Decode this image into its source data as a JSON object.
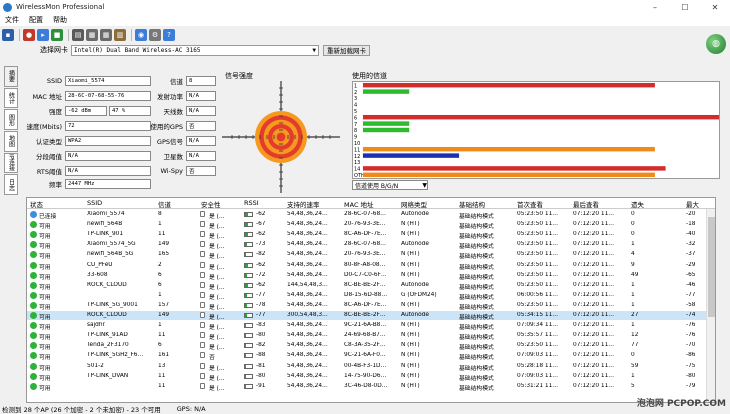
{
  "window": {
    "title": "WirelessMon Professional",
    "min": "–",
    "max": "☐",
    "close": "✕"
  },
  "menu": [
    "文件",
    "配置",
    "帮助"
  ],
  "toolbar": {
    "icons": [
      {
        "name": "save-icon",
        "color": "#2b5fa8",
        "glyph": "▪"
      },
      {
        "name": "record-icon",
        "color": "#c0392b",
        "glyph": "●"
      },
      {
        "name": "play-icon",
        "color": "#3b7dd8",
        "glyph": "▸"
      },
      {
        "name": "stop-icon",
        "color": "#2f8f3a",
        "glyph": "■"
      },
      {
        "name": "export-icon",
        "color": "#5a5a5a",
        "glyph": "▤"
      },
      {
        "name": "print-icon",
        "color": "#6b6b6b",
        "glyph": "▦"
      },
      {
        "name": "print-preview-icon",
        "color": "#6b6b6b",
        "glyph": "▦"
      },
      {
        "name": "log-icon",
        "color": "#8a6d3b",
        "glyph": "▥"
      },
      {
        "name": "wifi-icon",
        "color": "#3b7dd8",
        "glyph": "◉"
      },
      {
        "name": "settings-icon",
        "color": "#777",
        "glyph": "⚙"
      },
      {
        "name": "help-icon",
        "color": "#3b7dd8",
        "glyph": "?"
      }
    ]
  },
  "adapter": {
    "label": "选择网卡",
    "value": "Intel(R) Dual Band Wireless-AC 3165",
    "reload": "重新加载网卡"
  },
  "side_tabs": [
    "摘要",
    "统计",
    "图形",
    "地图",
    "IP连接",
    "日志"
  ],
  "info": {
    "ssid_label": "SSID",
    "ssid": "Xiaomi_5574",
    "mac_label": "MAC 地址",
    "mac": "28-6C-07-68-55-76",
    "strength_label": "强度",
    "strength_dbm": "-62 dBm",
    "strength_pct": "47 %",
    "rate_label": "速度(Mbits)",
    "rate": "72",
    "auth_label": "认证类型",
    "auth": "WPA2",
    "frag_label": "分段阈值",
    "frag": "N/A",
    "rts_label": "RTS阈值",
    "rts": "N/A",
    "freq_label": "频率",
    "freq": "2447 MHz",
    "channel_label": "信道",
    "channel": "8",
    "txpower_label": "发射功率",
    "txpower": "N/A",
    "antenna_label": "天线数",
    "antenna": "N/A",
    "gps_label": "使用的GPS",
    "gps": "否",
    "gpsnum_label": "GPS信号",
    "gpsnum": "N/A",
    "sat_label": "卫星数",
    "sat": "N/A",
    "wispy_label": "Wi-Spy",
    "wispy": "否"
  },
  "signal": {
    "title": "信号强度",
    "level_pct": 47,
    "rings": [
      "#f59a1e",
      "#e43c2c",
      "#f59a1e",
      "#e43c2c",
      "#f59a1e",
      "#e43c2c"
    ]
  },
  "channels": {
    "title": "使用的信道",
    "labels": [
      "1",
      "2",
      "3",
      "4",
      "5",
      "6",
      "7",
      "8",
      "9",
      "10",
      "11",
      "12",
      "13",
      "14",
      "OTH"
    ],
    "bars": [
      {
        "channel": "1",
        "value": 82,
        "color": "#d42b2b"
      },
      {
        "channel": "2",
        "value": 13,
        "color": "#2dbb2d"
      },
      {
        "channel": "6",
        "value": 100,
        "color": "#d42b2b"
      },
      {
        "channel": "7",
        "value": 13,
        "color": "#2dbb2d"
      },
      {
        "channel": "8",
        "value": 13,
        "color": "#2dbb2d"
      },
      {
        "channel": "11",
        "value": 82,
        "color": "#f08a18"
      },
      {
        "channel": "12",
        "value": 27,
        "color": "#1b2fb5"
      },
      {
        "channel": "14",
        "value": 85,
        "color": "#d42b2b"
      },
      {
        "channel": "OTH",
        "value": 82,
        "color": "#f08a18"
      }
    ],
    "filter": "信道使用 B/G/N"
  },
  "table": {
    "headers": [
      "状态",
      "SSID",
      "信道",
      "安全性",
      "RSSI",
      "支持的速率",
      "MAC 地址",
      "网络类型",
      "基础结构",
      "首次查看",
      "最后查看",
      "遗失",
      "最大"
    ],
    "rows": [
      {
        "status": "已连接",
        "ssid": "Xiaomi_5574",
        "ch": "8",
        "sec": "是 (…",
        "rssi": "-62",
        "rssi_fill": 47,
        "rates": "54,48,36,24…",
        "mac": "28-6C-07-68…",
        "ntype": "Autonode",
        "infra": "基础结构模式",
        "first": "05:23:50 11…",
        "last": "07:12:20 11…",
        "lost": "0",
        "max": "-20",
        "dot": "#3f8de0"
      },
      {
        "status": "可用",
        "ssid": "newifi_564B",
        "ch": "1",
        "sec": "是 (…",
        "rssi": "-67",
        "rssi_fill": 40,
        "rates": "54,48,36,24…",
        "mac": "20-76-93-3E…",
        "ntype": "N (HT)",
        "infra": "基础结构模式",
        "first": "05:23:50 11…",
        "last": "07:12:20 11…",
        "lost": "0",
        "max": "-18",
        "dot": "#2db23a"
      },
      {
        "status": "可用",
        "ssid": "TP-LINK_901",
        "ch": "11",
        "sec": "是 (…",
        "rssi": "-62",
        "rssi_fill": 47,
        "rates": "54,48,36,24…",
        "mac": "8C-A6-DF-7E…",
        "ntype": "N (HT)",
        "infra": "基础结构模式",
        "first": "05:23:50 11…",
        "last": "07:12:20 11…",
        "lost": "0",
        "max": "-40",
        "dot": "#2db23a"
      },
      {
        "status": "可用",
        "ssid": "Xiaomi_5574_5G",
        "ch": "149",
        "sec": "是 (…",
        "rssi": "-73",
        "rssi_fill": 30,
        "rates": "54,48,36,24…",
        "mac": "28-6C-07-68…",
        "ntype": "Autonode",
        "infra": "基础结构模式",
        "first": "05:23:50 11…",
        "last": "07:12:20 11…",
        "lost": "1",
        "max": "-32",
        "dot": "#2db23a"
      },
      {
        "status": "可用",
        "ssid": "newifi_564B_5G",
        "ch": "165",
        "sec": "是 (…",
        "rssi": "-82",
        "rssi_fill": 15,
        "rates": "54,48,36,24…",
        "mac": "20-76-93-3E…",
        "ntype": "N (HT)",
        "infra": "基础结构模式",
        "first": "05:23:50 11…",
        "last": "07:12:20 11…",
        "lost": "4",
        "max": "-37",
        "dot": "#2db23a"
      },
      {
        "status": "可用",
        "ssid": "CU_PFeU",
        "ch": "2",
        "sec": "是 (…",
        "rssi": "-62",
        "rssi_fill": 47,
        "rates": "54,48,36,24…",
        "mac": "80-8F-A8-08…",
        "ntype": "N (HT)",
        "infra": "基础结构模式",
        "first": "05:23:50 11…",
        "last": "07:12:20 11…",
        "lost": "9",
        "max": "-29",
        "dot": "#2db23a"
      },
      {
        "status": "可用",
        "ssid": "33-608",
        "ch": "6",
        "sec": "是 (…",
        "rssi": "-72",
        "rssi_fill": 32,
        "rates": "54,48,36,24…",
        "mac": "D0-C7-C0-6F…",
        "ntype": "N (HT)",
        "infra": "基础结构模式",
        "first": "05:23:50 11…",
        "last": "07:12:20 11…",
        "lost": "49",
        "max": "-65",
        "dot": "#2db23a"
      },
      {
        "status": "可用",
        "ssid": "ROCK_CLOUD",
        "ch": "6",
        "sec": "是 (…",
        "rssi": "-62",
        "rssi_fill": 47,
        "rates": "144,54,48,3…",
        "mac": "8C-BE-BE-2F…",
        "ntype": "Autonode",
        "infra": "基础结构模式",
        "first": "05:23:50 11…",
        "last": "07:12:20 11…",
        "lost": "1",
        "max": "-46",
        "dot": "#2db23a"
      },
      {
        "status": "可用",
        "ssid": "",
        "ch": "1",
        "sec": "是 (…",
        "rssi": "-77",
        "rssi_fill": 24,
        "rates": "54,48,36,24…",
        "mac": "D8-15-6D-88…",
        "ntype": "G (OFDM24)",
        "infra": "基础结构模式",
        "first": "06:00:56 11…",
        "last": "07:12:20 11…",
        "lost": "1",
        "max": "-77",
        "dot": "#2db23a"
      },
      {
        "status": "可用",
        "ssid": "TP-LINK_5G_9001",
        "ch": "157",
        "sec": "是 (…",
        "rssi": "-78",
        "rssi_fill": 22,
        "rates": "54,48,36,24…",
        "mac": "8C-A6-DF-7E…",
        "ntype": "N (HT)",
        "infra": "基础结构模式",
        "first": "05:23:50 11…",
        "last": "07:12:20 11…",
        "lost": "1",
        "max": "-58",
        "dot": "#2db23a"
      },
      {
        "status": "可用",
        "ssid": "ROCK_CLOUD",
        "ch": "149",
        "sec": "是 (…",
        "rssi": "-77",
        "rssi_fill": 24,
        "rates": "300,54,48,3…",
        "mac": "8C-BE-BE-2F…",
        "ntype": "Autonode",
        "infra": "基础结构模式",
        "first": "05:34:15 11…",
        "last": "07:12:20 11…",
        "lost": "27",
        "max": "-74",
        "dot": "#2db23a"
      },
      {
        "status": "可用",
        "ssid": "sajdhr",
        "ch": "1",
        "sec": "是 (…",
        "rssi": "-83",
        "rssi_fill": 13,
        "rates": "54,48,36,24…",
        "mac": "9C-21-6A-B8…",
        "ntype": "N (HT)",
        "infra": "基础结构模式",
        "first": "07:09:34 11…",
        "last": "07:12:20 11…",
        "lost": "1",
        "max": "-76",
        "dot": "#2db23a"
      },
      {
        "status": "可用",
        "ssid": "TP-LINK_91AD",
        "ch": "11",
        "sec": "是 (…",
        "rssi": "-80",
        "rssi_fill": 18,
        "rates": "54,48,36,24…",
        "mac": "24-69-68-B7…",
        "ntype": "N (HT)",
        "infra": "基础结构模式",
        "first": "05:35:57 11…",
        "last": "07:12:20 11…",
        "lost": "12",
        "max": "-76",
        "dot": "#2db23a"
      },
      {
        "status": "可用",
        "ssid": "Tenda_2F3170",
        "ch": "6",
        "sec": "是 (…",
        "rssi": "-82",
        "rssi_fill": 15,
        "rates": "54,48,36,24…",
        "mac": "C8-3A-35-2F…",
        "ntype": "N (HT)",
        "infra": "基础结构模式",
        "first": "05:23:50 11…",
        "last": "07:12:20 11…",
        "lost": "77",
        "max": "-70",
        "dot": "#2db23a"
      },
      {
        "status": "可用",
        "ssid": "TP-LINK_5GHz_F6…",
        "ch": "161",
        "sec": "否",
        "rssi": "-88",
        "rssi_fill": 5,
        "rates": "54,48,36,24…",
        "mac": "9C-21-6A-F0…",
        "ntype": "N (HT)",
        "infra": "基础结构模式",
        "first": "07:09:03 11…",
        "last": "07:12:20 11…",
        "lost": "0",
        "max": "-86",
        "dot": "#2db23a"
      },
      {
        "status": "可用",
        "ssid": "501-2",
        "ch": "13",
        "sec": "是 (…",
        "rssi": "-81",
        "rssi_fill": 16,
        "rates": "54,48,36,24…",
        "mac": "00-4B-F3-1D…",
        "ntype": "N (HT)",
        "infra": "基础结构模式",
        "first": "05:28:18 11…",
        "last": "07:12:20 11…",
        "lost": "59",
        "max": "-75",
        "dot": "#2db23a"
      },
      {
        "status": "可用",
        "ssid": "TP-LINK_DVAN",
        "ch": "11",
        "sec": "是 (…",
        "rssi": "-80",
        "rssi_fill": 18,
        "rates": "54,48,36,24…",
        "mac": "14-75-90-D6…",
        "ntype": "N (HT)",
        "infra": "基础结构模式",
        "first": "07:09:03 11…",
        "last": "07:12:20 11…",
        "lost": "1",
        "max": "-80",
        "dot": "#2db23a"
      },
      {
        "status": "可用",
        "ssid": "",
        "ch": "11",
        "sec": "是 (…",
        "rssi": "-91",
        "rssi_fill": 3,
        "rates": "54,48,36,24…",
        "mac": "3C-46-D8-0D…",
        "ntype": "N (HT)",
        "infra": "基础结构模式",
        "first": "05:31:21 11…",
        "last": "07:12:20 11…",
        "lost": "5",
        "max": "-79",
        "dot": "#2db23a"
      }
    ]
  },
  "status": "检测到 28 个AP (26 个加密 - 2 个未加密) - 23 个可用",
  "gps_status": "GPS: N/A",
  "watermark": "泡泡网 PCPOP.COM"
}
